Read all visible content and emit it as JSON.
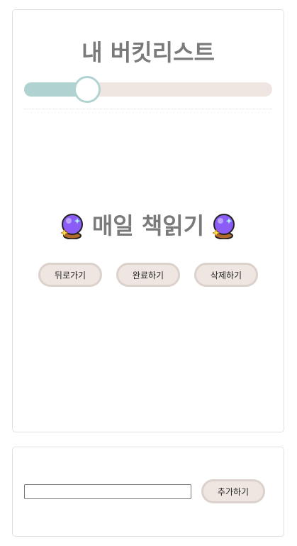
{
  "header": {
    "title": "내 버킷리스트"
  },
  "progress": {
    "value_fraction": 0.25
  },
  "current_item": {
    "text": "매일 책읽기",
    "icon_left": "crystal-ball-icon",
    "icon_right": "crystal-ball-icon"
  },
  "actions": {
    "back_label": "뒤로가기",
    "complete_label": "완료하기",
    "delete_label": "삭제하기"
  },
  "add_form": {
    "input_value": "",
    "input_placeholder": "",
    "add_label": "추가하기"
  },
  "colors": {
    "accent": "#b0d3d1",
    "track": "#f0e6e1",
    "button_bg": "#f0e6e1",
    "button_border": "#dcd2cd",
    "heading": "#7a7a7a"
  }
}
